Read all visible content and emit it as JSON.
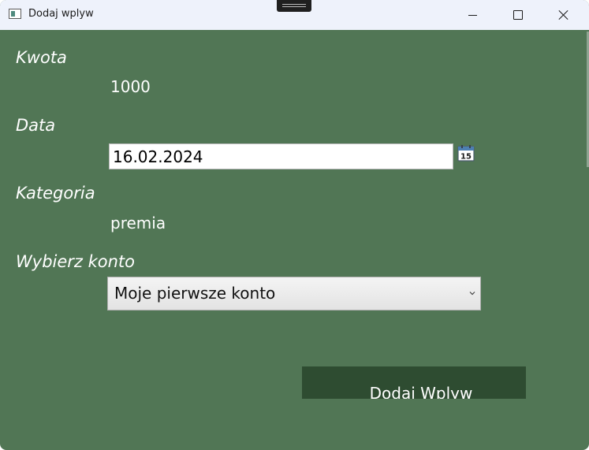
{
  "window": {
    "title": "Dodaj wplyw"
  },
  "form": {
    "amount_label": "Kwota",
    "amount_value": "1000",
    "date_label": "Data",
    "date_value": "16.02.2024",
    "calendar_day": "15",
    "category_label": "Kategoria",
    "category_value": "premia",
    "account_label": "Wybierz konto",
    "account_selected": "Moje pierwsze konto",
    "submit_label": "Dodaj Wplyw"
  },
  "icons": {
    "app": "app-window-icon",
    "calendar": "calendar-icon",
    "dropdown": "chevron-down-icon",
    "minimize": "minimize-icon",
    "maximize": "maximize-icon",
    "close": "close-icon"
  },
  "colors": {
    "background": "#517655",
    "titlebar": "#eef2fb",
    "button": "#2e4c31",
    "text": "#ffffff"
  }
}
